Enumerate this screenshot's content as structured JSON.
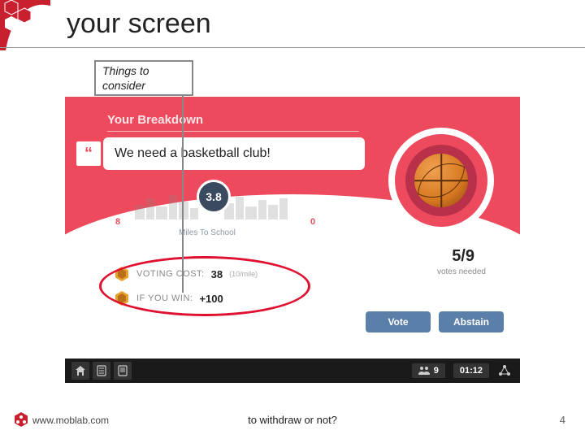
{
  "title": "your screen",
  "callout": {
    "line1": "Things to",
    "line2": "consider"
  },
  "game": {
    "breakdown_label": "Your Breakdown",
    "speech_text": "We need a basketball club!",
    "distance_value": "3.8",
    "axis_left": "8",
    "axis_right": "0",
    "axis_label": "Miles To School",
    "votes_fraction": "5/9",
    "votes_needed_label": "votes needed",
    "voting_cost": {
      "label": "VOTING COST:",
      "value": "38",
      "note": "(10/mile)"
    },
    "if_you_win": {
      "label": "IF YOU WIN:",
      "value": "+100"
    },
    "vote_button": "Vote",
    "abstain_button": "Abstain",
    "bottom_bar": {
      "count": "9",
      "time": "01:12"
    }
  },
  "footer": {
    "url": "www.moblab.com",
    "center": "to withdraw or not?",
    "page": "4"
  }
}
